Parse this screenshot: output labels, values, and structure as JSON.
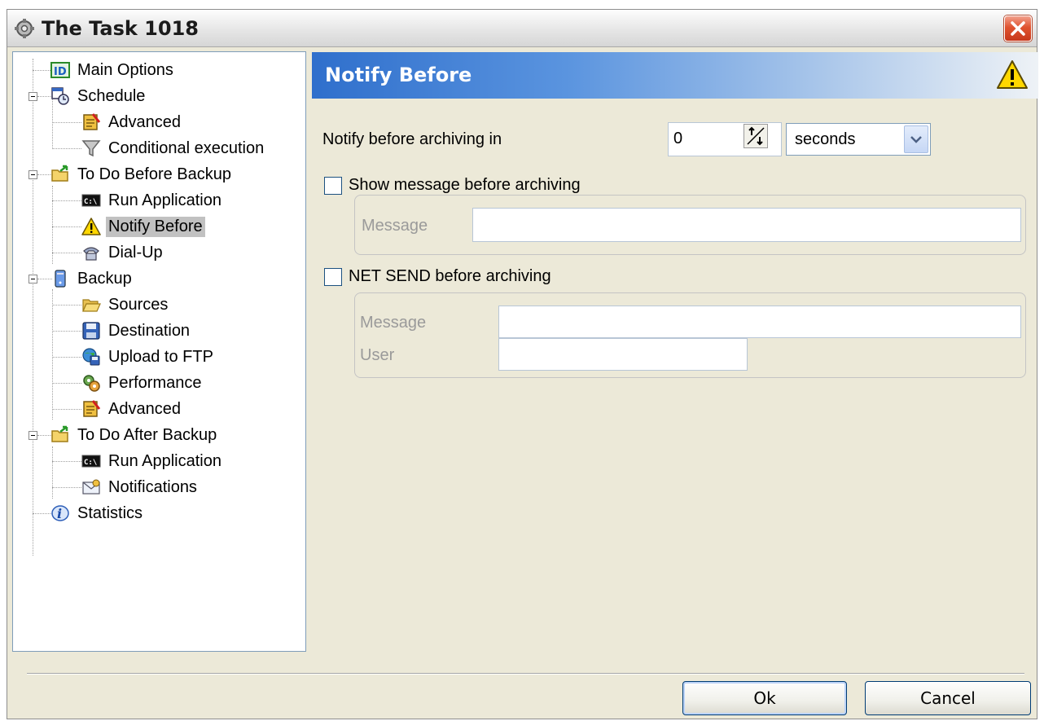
{
  "window": {
    "title": "The Task 1018"
  },
  "tree": {
    "items": [
      {
        "label": "Main Options",
        "icon": "id-icon"
      },
      {
        "label": "Schedule",
        "icon": "calendar-clock-icon"
      },
      {
        "label": "Advanced",
        "icon": "advanced-settings-icon"
      },
      {
        "label": "Conditional execution",
        "icon": "filter-icon"
      },
      {
        "label": "To Do Before Backup",
        "icon": "folder-arrow-icon"
      },
      {
        "label": "Run Application",
        "icon": "console-icon"
      },
      {
        "label": "Notify Before",
        "icon": "warning-icon"
      },
      {
        "label": "Dial-Up",
        "icon": "dialup-icon"
      },
      {
        "label": "Backup",
        "icon": "computer-icon"
      },
      {
        "label": "Sources",
        "icon": "folder-open-icon"
      },
      {
        "label": "Destination",
        "icon": "floppy-disk-icon"
      },
      {
        "label": "Upload to FTP",
        "icon": "globe-disk-icon"
      },
      {
        "label": "Performance",
        "icon": "gears-icon"
      },
      {
        "label": "Advanced",
        "icon": "advanced-settings-icon"
      },
      {
        "label": "To Do After Backup",
        "icon": "folder-arrow-icon"
      },
      {
        "label": "Run Application",
        "icon": "console-icon"
      },
      {
        "label": "Notifications",
        "icon": "envelope-icon"
      },
      {
        "label": "Statistics",
        "icon": "info-icon"
      }
    ],
    "selected": "Notify Before"
  },
  "panel": {
    "title": "Notify Before",
    "notify_label": "Notify before archiving in",
    "notify_value": "0",
    "unit_value": "seconds",
    "show_message_label": "Show message before archiving",
    "show_message_checked": false,
    "message_label": "Message",
    "message_value": "",
    "net_send_label": "NET SEND before archiving",
    "net_send_checked": false,
    "net_message_label": "Message",
    "net_message_value": "",
    "user_label": "User",
    "user_value": ""
  },
  "buttons": {
    "ok": "Ok",
    "cancel": "Cancel"
  },
  "colors": {
    "header_start": "#2f6fcc",
    "close_red": "#e0532f",
    "selection": "#c1c1c1"
  }
}
